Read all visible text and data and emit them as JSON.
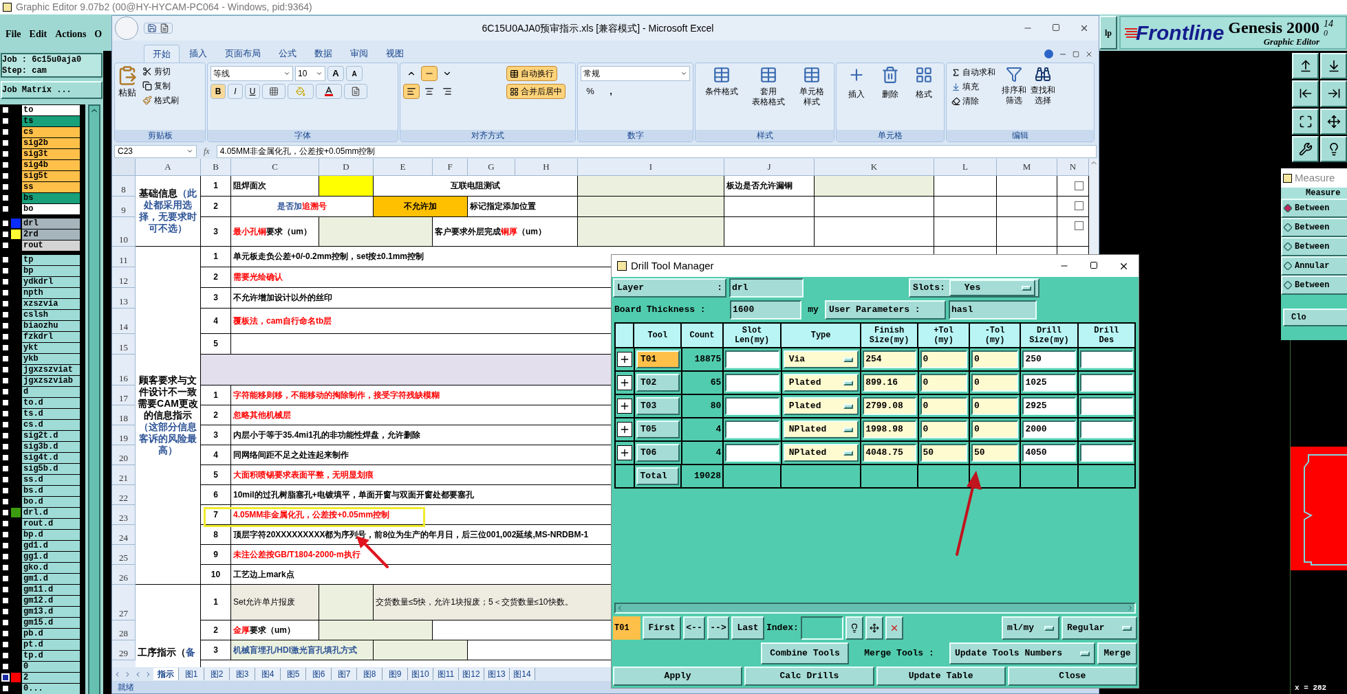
{
  "genesis": {
    "title": "Graphic Editor 9.07b2 (00@HY-HYCAM-PC064 - Windows, pid:9364)",
    "menu": [
      "File",
      "Edit",
      "Actions",
      "O"
    ],
    "job": "Job : 6c15u0aja0",
    "step": "Step: cam",
    "job_matrix": "Job Matrix ...",
    "layer_groups": [
      [
        {
          "name": "to",
          "color": "#ffffff",
          "checked": false
        },
        {
          "name": "ts",
          "color": "#17a07a",
          "checked": false
        },
        {
          "name": "cs",
          "color": "#ffc04a",
          "checked": false
        },
        {
          "name": "sig2b",
          "color": "#ffc04a",
          "checked": false
        },
        {
          "name": "sig3t",
          "color": "#ffc04a",
          "checked": false
        },
        {
          "name": "sig4b",
          "color": "#ffc04a",
          "checked": false
        },
        {
          "name": "sig5t",
          "color": "#ffc04a",
          "checked": false
        },
        {
          "name": "ss",
          "color": "#ffc04a",
          "checked": false
        },
        {
          "name": "bs",
          "color": "#17a07a",
          "checked": false
        },
        {
          "name": "bo",
          "color": "#ffffff",
          "checked": false
        }
      ],
      [
        {
          "name": "drl",
          "color": "#a6b4bc",
          "swatch": {
            "color": "#0a2cff"
          },
          "checked": false
        },
        {
          "name": "2rd",
          "color": "#a6b4bc",
          "swatch": {
            "color": "#ffff33"
          },
          "checked": false
        },
        {
          "name": "rout",
          "color": "#d4d4d4",
          "checked": false
        }
      ],
      [
        {
          "name": "tp",
          "color": "#9fdcd8",
          "checked": false
        },
        {
          "name": "bp",
          "color": "#9fdcd8",
          "checked": false
        },
        {
          "name": "ydkdrl",
          "color": "#9fdcd8",
          "checked": false
        },
        {
          "name": "npth",
          "color": "#9fdcd8",
          "checked": false
        },
        {
          "name": "xzszvia",
          "color": "#9fdcd8",
          "checked": false
        },
        {
          "name": "cslsh",
          "color": "#9fdcd8",
          "checked": false
        },
        {
          "name": "biaozhu",
          "color": "#9fdcd8",
          "checked": false
        },
        {
          "name": "fzkdrl",
          "color": "#9fdcd8",
          "checked": false
        },
        {
          "name": "ykt",
          "color": "#9fdcd8",
          "checked": false
        },
        {
          "name": "ykb",
          "color": "#9fdcd8",
          "checked": false
        },
        {
          "name": "jgxzszviat",
          "color": "#9fdcd8",
          "checked": false
        },
        {
          "name": "jgxzszviab",
          "color": "#9fdcd8",
          "checked": false
        },
        {
          "name": "d",
          "color": "#9fdcd8",
          "checked": false
        },
        {
          "name": "to.d",
          "color": "#9fdcd8",
          "checked": false
        },
        {
          "name": "ts.d",
          "color": "#9fdcd8",
          "checked": false
        },
        {
          "name": "cs.d",
          "color": "#9fdcd8",
          "checked": false
        },
        {
          "name": "sig2t.d",
          "color": "#9fdcd8",
          "checked": false
        },
        {
          "name": "sig3b.d",
          "color": "#9fdcd8",
          "checked": false
        },
        {
          "name": "sig4t.d",
          "color": "#9fdcd8",
          "checked": false
        },
        {
          "name": "sig5b.d",
          "color": "#9fdcd8",
          "checked": false
        },
        {
          "name": "ss.d",
          "color": "#9fdcd8",
          "checked": false
        },
        {
          "name": "bs.d",
          "color": "#9fdcd8",
          "checked": false
        },
        {
          "name": "bo.d",
          "color": "#9fdcd8",
          "checked": false
        },
        {
          "name": "drl.d",
          "color": "#9fdcd8",
          "swatch": {
            "color": "#3a9b0e"
          },
          "checked": false
        },
        {
          "name": "rout.d",
          "color": "#9fdcd8",
          "checked": false
        },
        {
          "name": "bp.d",
          "color": "#9fdcd8",
          "checked": false
        },
        {
          "name": "gd1.d",
          "color": "#9fdcd8",
          "checked": false
        },
        {
          "name": "gg1.d",
          "color": "#9fdcd8",
          "checked": false
        },
        {
          "name": "gko.d",
          "color": "#9fdcd8",
          "checked": false
        },
        {
          "name": "gm1.d",
          "color": "#9fdcd8",
          "checked": false
        },
        {
          "name": "gm11.d",
          "color": "#9fdcd8",
          "checked": false
        },
        {
          "name": "gm12.d",
          "color": "#9fdcd8",
          "checked": false
        },
        {
          "name": "gm13.d",
          "color": "#9fdcd8",
          "checked": false
        },
        {
          "name": "gm15.d",
          "color": "#9fdcd8",
          "checked": false
        },
        {
          "name": "pb.d",
          "color": "#9fdcd8",
          "checked": false
        },
        {
          "name": "pt.d",
          "color": "#9fdcd8",
          "checked": false
        },
        {
          "name": "tp.d",
          "color": "#9fdcd8",
          "checked": false
        },
        {
          "name": "0",
          "color": "#9fdcd8",
          "checked": false
        },
        {
          "name": "2",
          "color": "#9fdcd8",
          "swatch": {
            "color": "#ff0000"
          },
          "checked": true
        },
        {
          "name": "0...",
          "color": "#9fdcd8",
          "checked": false
        }
      ]
    ],
    "help_button": "lp",
    "logo": "Frontline",
    "product": "Genesis 2000",
    "subtitle": "Graphic Editor",
    "version": "14",
    "version_2": "0",
    "coordinate": "x = 282"
  },
  "measure": {
    "title": "Measure",
    "header": "Measure",
    "options": [
      {
        "label": "Between",
        "selected": true
      },
      {
        "label": "Between",
        "selected": false
      },
      {
        "label": "Between",
        "selected": false
      },
      {
        "label": "Annular",
        "selected": false
      },
      {
        "label": "Between",
        "selected": false
      }
    ],
    "close": "Clo"
  },
  "excel": {
    "title": "6C15U0AJA0预审指示.xls  [兼容模式] - Microsoft Excel",
    "tabs": [
      {
        "label": "开始",
        "selected": true
      },
      {
        "label": "插入",
        "selected": false
      },
      {
        "label": "页面布局",
        "selected": false
      },
      {
        "label": "公式",
        "selected": false
      },
      {
        "label": "数据",
        "selected": false
      },
      {
        "label": "审阅",
        "selected": false
      },
      {
        "label": "视图",
        "selected": false
      }
    ],
    "clipboard": {
      "paste": "粘贴",
      "cut": "剪切",
      "copy": "复制",
      "painter": "格式刷",
      "label": "剪贴板"
    },
    "font": {
      "name": "等线",
      "size": "10",
      "grow": "A",
      "shrink": "A",
      "bold": "B",
      "italic": "I",
      "underline": "U",
      "label": "字体"
    },
    "alignment": {
      "vertical": [
        {
          "on": false
        },
        {
          "on": true
        },
        {
          "on": false
        }
      ],
      "horizontal": [
        {
          "on": true
        },
        {
          "on": false
        },
        {
          "on": false
        }
      ],
      "wrap": {
        "label": "自动换行",
        "on": true
      },
      "merge": {
        "label": "合并后居中",
        "on": true
      },
      "label": "对齐方式"
    },
    "number": {
      "format": "常规",
      "percent": "%",
      "comma": ",",
      "label": "数字"
    },
    "styles": {
      "buttons": [
        [
          "条件格式"
        ],
        [
          "套用",
          "表格格式"
        ],
        [
          "单元格",
          "样式"
        ]
      ],
      "label": "样式"
    },
    "cells_group": {
      "buttons": [
        "插入",
        "删除",
        "格式"
      ],
      "label": "单元格"
    },
    "editing": {
      "autosum": "自动求和",
      "fill": "填充",
      "clear": "清除",
      "sort": [
        "排序和",
        "筛选"
      ],
      "find": [
        "查找和",
        "选择"
      ],
      "label": "编辑"
    },
    "formula": {
      "name_box": "C23",
      "fx": "fx",
      "value": "4.05MM非金属化孔，公差按+0.05mm控制"
    },
    "columns": [
      "A",
      "B",
      "C",
      "D",
      "E",
      "F",
      "G",
      "H",
      "I",
      "J",
      "K",
      "L",
      "M",
      "N"
    ],
    "row_numbers": [
      "8",
      "9",
      "10",
      "11",
      "12",
      "13",
      "14",
      "15",
      "16",
      "17",
      "18",
      "19",
      "20",
      "21",
      "22",
      "23",
      "24",
      "25",
      "26",
      "27",
      "28",
      "29"
    ],
    "cells": [
      {
        "parts": [
          {
            "text": "基础信息",
            "color": "#000000"
          },
          {
            "text": "（此处都采用选择，无要求时可不选）",
            "color": "#2f5597"
          }
        ]
      },
      {
        "text": "1",
        "color": "#000000"
      },
      {
        "text": "阻焊面次",
        "color": "#000000"
      },
      {
        "fill": {
          "color": "#ffff00"
        }
      },
      {
        "text": "互联电阻测试",
        "color": "#000000"
      },
      {
        "fill": {
          "color": "#ebf1de"
        }
      },
      {
        "text": "板边是否允许漏铜",
        "color": "#000000"
      },
      {
        "fill": {
          "color": "#ebf1de"
        }
      },
      {
        "text": "2",
        "color": "#000000"
      },
      {
        "parts": [
          {
            "text": "是否加",
            "color": "#2f5597"
          },
          {
            "text": "追溯号",
            "color": "#ff0000"
          }
        ]
      },
      {
        "text": "不允许加",
        "color": "#000000",
        "fill": {
          "color": "#ffc000"
        }
      },
      {
        "text": "标记指定添加位置",
        "color": "#000000"
      },
      {
        "fill": {
          "color": "#ebf1de"
        }
      },
      {
        "text": "3",
        "color": "#000000"
      },
      {
        "parts": [
          {
            "text": "最小孔铜",
            "color": "#ff0000"
          },
          {
            "text": "要求（um）",
            "color": "#000000"
          }
        ]
      },
      {
        "fill": {
          "color": "#ebf1de"
        }
      },
      {
        "parts": [
          {
            "text": "客户要求外层完成",
            "color": "#000000"
          },
          {
            "text": "铜厚",
            "color": "#ff0000"
          },
          {
            "text": "（um）",
            "color": "#000000"
          }
        ]
      },
      {
        "fill": {
          "color": "#ebf1de"
        }
      },
      {
        "parts": [
          {
            "text": "顾客要求与文件设计不一致需要CAM更改的信息指示",
            "color": "#000000"
          },
          {
            "text": "（这部分信息客诉的风险最高）",
            "color": "#2f5597"
          }
        ]
      },
      {
        "text": "1",
        "color": "#000000"
      },
      {
        "text": "单元板走负公差+0/-0.2mm控制，set按±0.1mm控制",
        "color": "#000000"
      },
      {
        "text": "2",
        "color": "#000000"
      },
      {
        "text": "需要光绘确认",
        "color": "#ff0000"
      },
      {
        "text": "3",
        "color": "#000000"
      },
      {
        "text": "不允许增加设计以外的丝印",
        "color": "#000000"
      },
      {
        "text": "4",
        "color": "#000000"
      },
      {
        "text": "覆板法，cam自行命名tb层",
        "color": "#ff0000"
      },
      {
        "text": "5",
        "color": "#000000"
      },
      {
        "fill": {
          "color": "#e4dfec"
        }
      },
      {
        "text": "1",
        "color": "#000000"
      },
      {
        "text": "字符能移则移，不能移动的掏除制作，接受字符残缺模糊",
        "color": "#ff0000"
      },
      {
        "text": "2",
        "color": "#000000"
      },
      {
        "text": "忽略其他机械层",
        "color": "#ff0000"
      },
      {
        "text": "3",
        "color": "#000000"
      },
      {
        "text": "内层小于等于35.4mi1孔的非功能性焊盘，允许删除",
        "color": "#000000"
      },
      {
        "text": "4",
        "color": "#000000"
      },
      {
        "text": "同网络间距不足之处连起来制作",
        "color": "#000000"
      },
      {
        "text": "5",
        "color": "#000000"
      },
      {
        "text": "大面积喷锡要求表面平整，无明显划痕",
        "color": "#ff0000"
      },
      {
        "text": "6",
        "color": "#000000"
      },
      {
        "text": "10mil的过孔树脂塞孔+电镀填平，单面开窗与双面开窗处都要塞孔",
        "color": "#000000"
      },
      {
        "text": "7",
        "color": "#000000"
      },
      {
        "text": "4.05MM非金属化孔，公差按+0.05mm控制",
        "color": "#ff0000"
      },
      {
        "text": "8",
        "color": "#000000"
      },
      {
        "text": "顶层字符20XXXXXXXXX都为序列号，前8位为生产的年月日，后三位001,002延续,MS-NRDBM-1",
        "color": "#000000"
      },
      {
        "text": "9",
        "color": "#000000"
      },
      {
        "text": "未注公差按GB/T1804-2000-m执行",
        "color": "#ff0000"
      },
      {
        "text": "10",
        "color": "#000000"
      },
      {
        "text": "工艺边上mark点",
        "color": "#000000"
      },
      {
        "parts": [
          {
            "text": "工序指示（",
            "color": "#000000"
          },
          {
            "text": "备",
            "color": "#2f5597"
          }
        ]
      },
      {
        "text": "1",
        "color": "#000000"
      },
      {
        "text": "Set允许单片报废",
        "color": "#000000",
        "fill": {
          "color": "#eeece1"
        }
      },
      {
        "fill": {
          "color": "#ebf1de"
        }
      },
      {
        "text": "交货数量≤5快，允许1块报废；5＜交货数量≤10快数。",
        "color": "#000000",
        "fill": {
          "color": "#eeece1"
        }
      },
      {
        "text": "2",
        "color": "#000000"
      },
      {
        "parts": [
          {
            "text": "金厚",
            "color": "#ff0000"
          },
          {
            "text": "要求（um）",
            "color": "#000000"
          }
        ]
      },
      {
        "fill": {
          "color": "#ebf1de"
        }
      },
      {
        "text": "3",
        "color": "#000000"
      },
      {
        "text": "机械盲埋孔/HDI激光盲孔填孔方式",
        "color": "#2f5597",
        "fill": {
          "color": "#ebf1de"
        }
      },
      {
        "fill": {
          "color": "#ebf1de"
        }
      }
    ],
    "form_checkboxes": [
      {
        "checked": false
      },
      {
        "checked": false
      },
      {
        "checked": false
      }
    ],
    "sheet_tabs": [
      {
        "label": "指示",
        "selected": true
      },
      {
        "label": "图1",
        "selected": false
      },
      {
        "label": "图2",
        "selected": false
      },
      {
        "label": "图3",
        "selected": false
      },
      {
        "label": "图4",
        "selected": false
      },
      {
        "label": "图5",
        "selected": false
      },
      {
        "label": "图6",
        "selected": false
      },
      {
        "label": "图7",
        "selected": false
      },
      {
        "label": "图8",
        "selected": false
      },
      {
        "label": "图9",
        "selected": false
      },
      {
        "label": "图10",
        "selected": false
      },
      {
        "label": "图11",
        "selected": false
      },
      {
        "label": "图12",
        "selected": false
      },
      {
        "label": "图13",
        "selected": false
      },
      {
        "label": "图14",
        "selected": false
      }
    ],
    "status": "就绪"
  },
  "drill_tool_manager": {
    "title": "Drill Tool Manager",
    "layer_label": "Layer",
    "layer_sep": ":",
    "layer": "drl",
    "slots_label": "Slots:",
    "slots": "Yes",
    "thickness_label": "Board Thickness :",
    "thickness": "1600",
    "thickness_unit": "my",
    "params_label": "User Parameters :",
    "params": "hasl",
    "columns": [
      [
        "Tool"
      ],
      [
        "Count"
      ],
      [
        "Slot",
        "Len(my)"
      ],
      [
        "Type"
      ],
      [
        "Finish",
        "Size(my)"
      ],
      [
        "+Tol",
        "(my)"
      ],
      [
        "-Tol",
        "(my)"
      ],
      [
        "Drill",
        "Size(my)"
      ],
      [
        "Drill",
        "Des"
      ]
    ],
    "rows": [
      {
        "tool": "T01",
        "count": "18875",
        "type": "Via",
        "finish": "254",
        "plus_tol": "0",
        "minus_tol": "0",
        "drill_size": "250",
        "selected": true
      },
      {
        "tool": "T02",
        "count": "65",
        "type": "Plated",
        "finish": "899.16",
        "plus_tol": "0",
        "minus_tol": "0",
        "drill_size": "1025",
        "selected": false
      },
      {
        "tool": "T03",
        "count": "80",
        "type": "Plated",
        "finish": "2799.08",
        "plus_tol": "0",
        "minus_tol": "0",
        "drill_size": "2925",
        "selected": false
      },
      {
        "tool": "T05",
        "count": "4",
        "type": "NPlated",
        "finish": "1998.98",
        "plus_tol": "0",
        "minus_tol": "0",
        "drill_size": "2000",
        "selected": false
      },
      {
        "tool": "T06",
        "count": "4",
        "type": "NPlated",
        "finish": "4048.75",
        "plus_tol": "50",
        "minus_tol": "50",
        "drill_size": "4050",
        "selected": false
      }
    ],
    "total_label": "Total",
    "total": "19028",
    "current": "T01",
    "first": "First",
    "prev": "<--",
    "next": "-->",
    "last": "Last",
    "index_label": "Index:",
    "units": "ml/my",
    "mode": "Regular",
    "combine": "Combine Tools",
    "merge_label": "Merge Tools :",
    "merge_mode": "Update Tools Numbers",
    "merge": "Merge",
    "buttons": [
      "Apply",
      "Calc Drills",
      "Update Table",
      "Close"
    ]
  }
}
